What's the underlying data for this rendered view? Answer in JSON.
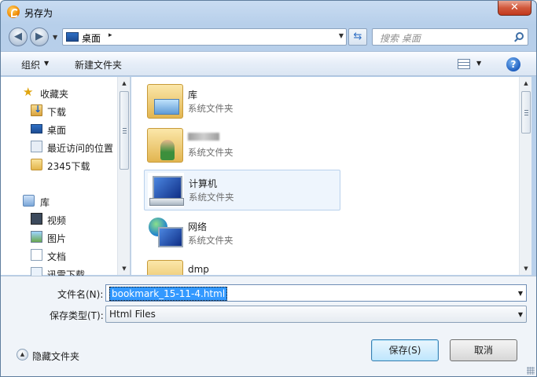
{
  "window": {
    "title": "另存为",
    "close_label": "✕"
  },
  "address": {
    "location": "桌面",
    "separator": "▸"
  },
  "search": {
    "placeholder": "搜索 桌面"
  },
  "toolbar": {
    "organize_label": "组织",
    "new_folder_label": "新建文件夹",
    "help_label": "?"
  },
  "sidebar": {
    "items": [
      {
        "label": "收藏夹",
        "icon": "star-icon"
      },
      {
        "label": "下载",
        "icon": "downloads-folder-icon"
      },
      {
        "label": "桌面",
        "icon": "desktop-icon"
      },
      {
        "label": "最近访问的位置",
        "icon": "recent-places-icon"
      },
      {
        "label": "2345下载",
        "icon": "folder-icon"
      },
      {
        "label": "库",
        "icon": "library-icon"
      },
      {
        "label": "视频",
        "icon": "video-library-icon"
      },
      {
        "label": "图片",
        "icon": "pictures-library-icon"
      },
      {
        "label": "文档",
        "icon": "documents-library-icon"
      },
      {
        "label": "迅雷下载",
        "icon": "thunder-download-icon"
      }
    ]
  },
  "files": {
    "items": [
      {
        "name": "库",
        "kind": "系统文件夹",
        "icon": "library-folder-icon"
      },
      {
        "name": "",
        "kind": "系统文件夹",
        "icon": "user-folder-icon",
        "name_redacted": true
      },
      {
        "name": "计算机",
        "kind": "系统文件夹",
        "icon": "computer-icon",
        "selected": true
      },
      {
        "name": "网络",
        "kind": "系统文件夹",
        "icon": "network-icon"
      },
      {
        "name": "dmp",
        "kind": "",
        "icon": "folder-icon"
      }
    ]
  },
  "form": {
    "filename_label": "文件名(N):",
    "filename_value": "bookmark_15-11-4.html",
    "filetype_label": "保存类型(T):",
    "filetype_value": "Html Files",
    "hide_folders_label": "隐藏文件夹",
    "save_label": "保存(S)",
    "cancel_label": "取消"
  }
}
